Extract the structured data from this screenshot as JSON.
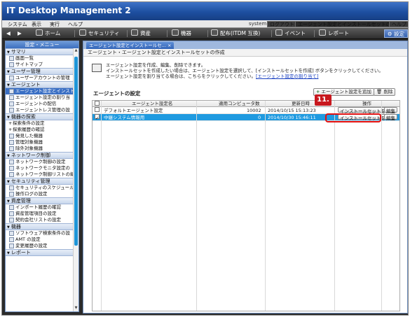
{
  "app": {
    "title": "IT Desktop Management 2"
  },
  "menu": {
    "items": [
      "システム",
      "表示",
      "実行",
      "ヘルプ"
    ],
    "system_label": "system",
    "logout": "ログアウト",
    "context_title": "エージェント設定とインストールセットの作成",
    "help": "ヘルプ"
  },
  "nav": {
    "home": "ホーム",
    "security": "セキュリティ",
    "assets": "資産",
    "equipment": "機器",
    "distribution": "配布(ITDM 互換)",
    "events": "イベント",
    "reports": "レポート",
    "settings": "設定"
  },
  "sidebar": {
    "header": "設定・メニュー",
    "sections": [
      {
        "title": "サマリ",
        "items": [
          "画面一覧",
          "サイトマップ"
        ]
      },
      {
        "title": "ユーザー管理",
        "items": [
          "ユーザーアカウントの管理"
        ]
      },
      {
        "title": "エージェント",
        "items": [
          "エージェント設定とインスト",
          "エージェント設定の割り当",
          "エージェントの配信",
          "エージェントレス管理の設"
        ]
      },
      {
        "title": "機器の探索",
        "items": [
          "探索条件の設定",
          "探索履歴の確認",
          "発見した機器",
          "管理対象機器",
          "除外対象機器"
        ]
      },
      {
        "title": "ネットワーク制御",
        "items": [
          "ネットワーク制御の設定",
          "ネットワークモニタ設定の",
          "ネットワーク制御リストの編"
        ]
      },
      {
        "title": "セキュリティ管理",
        "items": [
          "セキュリティのスケジュール",
          "操作ログの設定"
        ]
      },
      {
        "title": "資産管理",
        "items": [
          "インポート履歴の確認",
          "資産管理項目の設定",
          "契約会社リストの設定"
        ]
      },
      {
        "title": "機器",
        "items": [
          "ソフトウェア検索条件の設",
          "AMT の設定",
          "変更履歴の設定"
        ]
      },
      {
        "title": "レポート",
        "items": []
      }
    ]
  },
  "main": {
    "tab": "エージェント設定とインストールセ...",
    "page_title": "エージェント・エージェント設定とインストールセットの作成",
    "info_line1": "エージェント設定を作成、編集、削除できます。",
    "info_line2": "インストールセットを作成したい場合は、エージェント設定を選択して、[インストールセットを作成] ボタンをクリックしてください。",
    "info_line3_prefix": "エージェント設定を割り当てる場合は、こちらをクリックしてください。",
    "info_link": "[エージェント設定の割り当て]",
    "section_title": "エージェントの設定",
    "add_button": "エージェント設定を追加",
    "delete_button": "削除",
    "step_label": "11."
  },
  "table": {
    "columns": [
      "エージェント設定名",
      "適用コンピュータ数",
      "更新日時",
      "操作"
    ],
    "rows": [
      {
        "name": "デフォルトエージェント設定",
        "count": "10002",
        "updated": "2014/10/15 15:13:23",
        "create": "インストールセットを作成",
        "edit": "編集",
        "checked": false,
        "selected": false
      },
      {
        "name": "中継システム情報用",
        "count": "0",
        "updated": "2014/10/30 15:46:11",
        "create": "インストールセットを作成",
        "edit": "編集",
        "checked": true,
        "selected": true
      }
    ]
  },
  "colors": {
    "accent": "#1f9ae0",
    "title_bar": "#1d4fa0",
    "highlight": "#e01010"
  }
}
